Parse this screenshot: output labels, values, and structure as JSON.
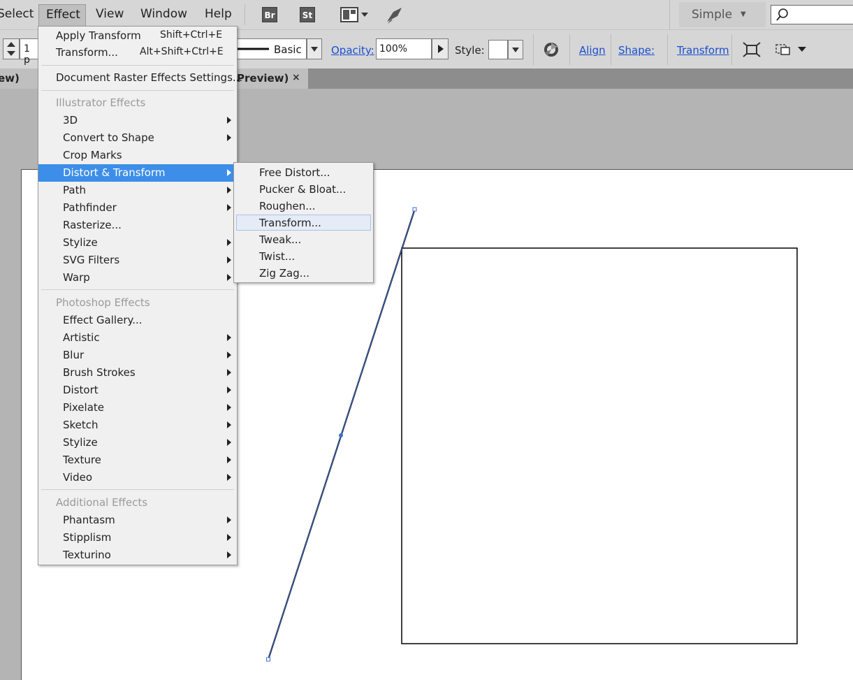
{
  "menubar": {
    "items": [
      "Select",
      "Effect",
      "View",
      "Window",
      "Help"
    ],
    "workspace": "Simple",
    "search_placeholder": ""
  },
  "controlbar": {
    "stroke_weight": "1 p",
    "brush": "Basic",
    "opacity_label": "Opacity:",
    "opacity_value": "100%",
    "style_label": "Style:",
    "align_label": "Align",
    "shape_label": "Shape:",
    "transform_label": "Transform"
  },
  "tabs": [
    {
      "label": "ew)",
      "close": "×"
    },
    {
      "label": "Preview)",
      "close": "×"
    }
  ],
  "effect_menu": {
    "top_items": [
      {
        "label": "Apply Transform",
        "shortcut": "Shift+Ctrl+E"
      },
      {
        "label": "Transform...",
        "shortcut": "Alt+Shift+Ctrl+E"
      }
    ],
    "raster_settings": "Document Raster Effects Settings...",
    "illustrator_header": "Illustrator Effects",
    "illustrator_items": [
      "3D",
      "Convert to Shape",
      "Crop Marks",
      "Distort & Transform",
      "Path",
      "Pathfinder",
      "Rasterize...",
      "Stylize",
      "SVG Filters",
      "Warp"
    ],
    "photoshop_header": "Photoshop Effects",
    "photoshop_items": [
      "Effect Gallery...",
      "Artistic",
      "Blur",
      "Brush Strokes",
      "Distort",
      "Pixelate",
      "Sketch",
      "Stylize",
      "Texture",
      "Video"
    ],
    "additional_header": "Additional Effects",
    "additional_items": [
      "Phantasm",
      "Stipplism",
      "Texturino"
    ]
  },
  "distort_submenu": {
    "items": [
      "Free Distort...",
      "Pucker & Bloat...",
      "Roughen...",
      "Transform...",
      "Tweak...",
      "Twist...",
      "Zig Zag..."
    ],
    "hovered": "Transform..."
  },
  "colors": {
    "highlight": "#3d8ee8",
    "link": "#1a4fcf",
    "selection": "#3b6fd6"
  }
}
